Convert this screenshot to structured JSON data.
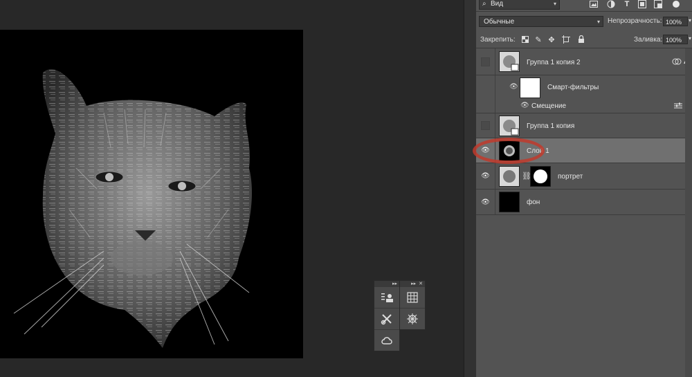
{
  "layers_search": {
    "filter_kind": "Вид"
  },
  "blend": {
    "mode": "Обычные",
    "opacity_label": "Непрозрачность:",
    "opacity_value": "100%"
  },
  "lock": {
    "label": "Закрепить:",
    "fill_label": "Заливка:",
    "fill_value": "100%"
  },
  "layers": [
    {
      "name": "Группа 1 копия 2",
      "visible": false,
      "type": "smart-object"
    },
    {
      "name": "Смарт-фильтры",
      "visible": true,
      "type": "smart-filters"
    },
    {
      "name": "Смещение",
      "visible": true,
      "type": "filter"
    },
    {
      "name": "Группа 1 копия",
      "visible": false,
      "type": "smart-object"
    },
    {
      "name": "Слой 1",
      "visible": true,
      "type": "layer",
      "selected": true
    },
    {
      "name": "портрет",
      "visible": true,
      "type": "layer-with-mask"
    },
    {
      "name": "фон",
      "visible": true,
      "type": "layer"
    }
  ],
  "colors": {
    "panel": "#535353",
    "workspace": "#282828",
    "selected_layer": "#707070",
    "highlight_circle": "#c0392b"
  },
  "icons": [
    "search-icon",
    "image-filter-icon",
    "adjust-filter-icon",
    "text-filter-icon",
    "shape-filter-icon",
    "smart-filter-icon",
    "lock-pixels-icon",
    "lock-brush-icon",
    "lock-move-icon",
    "lock-artboard-icon",
    "lock-all-icon",
    "properties-icon",
    "grid-icon",
    "brush-tools-icon",
    "compass-icon",
    "creative-cloud-icon",
    "link-icon",
    "eye-icon"
  ]
}
